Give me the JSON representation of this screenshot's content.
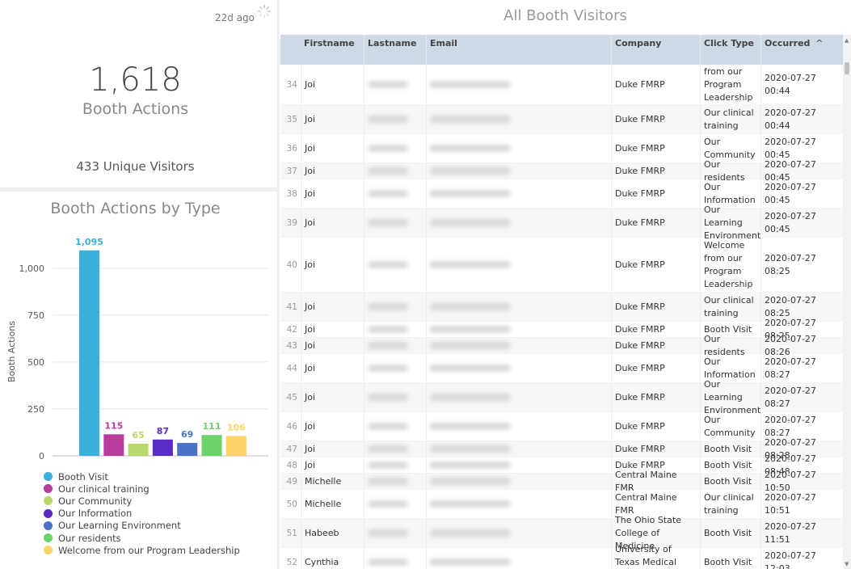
{
  "kpi": {
    "time_ago": "22d ago",
    "total_actions": "1,618",
    "total_actions_label": "Booth Actions",
    "unique_visitors": "433 Unique Visitors"
  },
  "chart_data": {
    "type": "bar",
    "title": "Booth Actions by Type",
    "ylabel": "Booth Actions",
    "xlabel": "",
    "ylim": [
      0,
      1150
    ],
    "yticks": [
      0,
      250,
      500,
      750,
      1000
    ],
    "ytick_labels": [
      "0",
      "250",
      "500",
      "750",
      "1,000"
    ],
    "grid": true,
    "legend_position": "bottom",
    "series": [
      {
        "name": "Booth Visit",
        "value": 1095,
        "label": "1,095",
        "color": "#3bb0d9"
      },
      {
        "name": "Our clinical training",
        "value": 115,
        "label": "115",
        "color": "#b83c9c"
      },
      {
        "name": "Our Community",
        "value": 65,
        "label": "65",
        "color": "#b9d86a"
      },
      {
        "name": "Our Information",
        "value": 87,
        "label": "87",
        "color": "#5b2bc6"
      },
      {
        "name": "Our Learning Environment",
        "value": 69,
        "label": "69",
        "color": "#4a73c7"
      },
      {
        "name": "Our residents",
        "value": 111,
        "label": "111",
        "color": "#6cd36c"
      },
      {
        "name": "Welcome from our Program Leadership",
        "value": 106,
        "label": "106",
        "color": "#ffd36a"
      }
    ]
  },
  "table": {
    "title": "All Booth Visitors",
    "columns": [
      "Firstname",
      "Lastname",
      "Email",
      "Company",
      "Click Type",
      "Occurred"
    ],
    "sort_indicator": "^",
    "rows": [
      {
        "num": "34",
        "first": "Joi",
        "company": "Duke FMRP",
        "click": "from our Program Leadership",
        "occurred": "2020-07-27 00:44"
      },
      {
        "num": "35",
        "first": "Joi",
        "company": "Duke FMRP",
        "click": "Our clinical training",
        "occurred": "2020-07-27 00:44"
      },
      {
        "num": "36",
        "first": "Joi",
        "company": "Duke FMRP",
        "click": "Our Community",
        "occurred": "2020-07-27 00:45"
      },
      {
        "num": "37",
        "first": "Joi",
        "company": "Duke FMRP",
        "click": "Our residents",
        "occurred": "2020-07-27 00:45"
      },
      {
        "num": "38",
        "first": "Joi",
        "company": "Duke FMRP",
        "click": "Our Information",
        "occurred": "2020-07-27 00:45"
      },
      {
        "num": "39",
        "first": "Joi",
        "company": "Duke FMRP",
        "click": "Our Learning Environment",
        "occurred": "2020-07-27 00:45"
      },
      {
        "num": "40",
        "first": "Joi",
        "company": "Duke FMRP",
        "click": "Welcome from our Program Leadership",
        "occurred": "2020-07-27 08:25"
      },
      {
        "num": "41",
        "first": "Joi",
        "company": "Duke FMRP",
        "click": "Our clinical training",
        "occurred": "2020-07-27 08:25"
      },
      {
        "num": "42",
        "first": "Joi",
        "company": "Duke FMRP",
        "click": "Booth Visit",
        "occurred": "2020-07-27 08:25"
      },
      {
        "num": "43",
        "first": "Joi",
        "company": "Duke FMRP",
        "click": "Our residents",
        "occurred": "2020-07-27 08:26"
      },
      {
        "num": "44",
        "first": "Joi",
        "company": "Duke FMRP",
        "click": "Our Information",
        "occurred": "2020-07-27 08:27"
      },
      {
        "num": "45",
        "first": "Joi",
        "company": "Duke FMRP",
        "click": "Our Learning Environment",
        "occurred": "2020-07-27 08:27"
      },
      {
        "num": "46",
        "first": "Joi",
        "company": "Duke FMRP",
        "click": "Our Community",
        "occurred": "2020-07-27 08:27"
      },
      {
        "num": "47",
        "first": "Joi",
        "company": "Duke FMRP",
        "click": "Booth Visit",
        "occurred": "2020-07-27 08:28"
      },
      {
        "num": "48",
        "first": "Joi",
        "company": "Duke FMRP",
        "click": "Booth Visit",
        "occurred": "2020-07-27 08:48"
      },
      {
        "num": "49",
        "first": "Michelle",
        "company": "Central Maine FMR",
        "click": "Booth Visit",
        "occurred": "2020-07-27 10:50"
      },
      {
        "num": "50",
        "first": "Michelle",
        "company": "Central Maine FMR",
        "click": "Our clinical training",
        "occurred": "2020-07-27 10:51"
      },
      {
        "num": "51",
        "first": "Habeeb",
        "company": "The Ohio State College of Medicine",
        "click": "Booth Visit",
        "occurred": "2020-07-27 11:51"
      },
      {
        "num": "52",
        "first": "Cynthia",
        "company": "University of Texas Medical Branch",
        "click": "Booth Visit",
        "occurred": "2020-07-27 12:03"
      }
    ]
  }
}
